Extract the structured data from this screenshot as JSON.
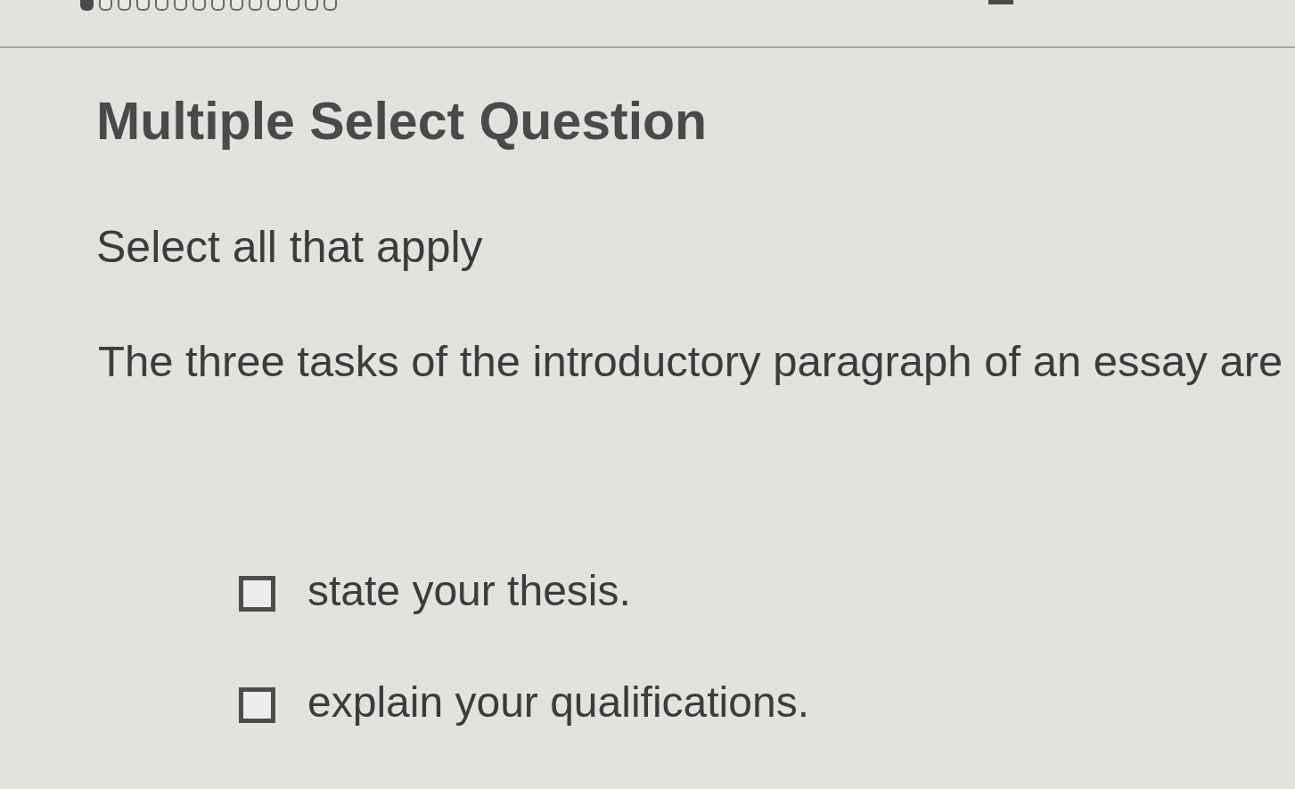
{
  "progress_markers": [
    {
      "filled": true
    },
    {
      "filled": false
    },
    {
      "filled": false
    },
    {
      "filled": false
    },
    {
      "filled": false
    },
    {
      "filled": false
    },
    {
      "filled": false
    },
    {
      "filled": false
    },
    {
      "filled": false
    },
    {
      "filled": false
    },
    {
      "filled": false
    },
    {
      "filled": false
    },
    {
      "filled": false
    },
    {
      "filled": false
    }
  ],
  "title": "Multiple Select Question",
  "instruction": "Select all that apply",
  "question": "The three tasks of the introductory paragraph of an essay are",
  "options": [
    {
      "label": "state your thesis.",
      "checked": false
    },
    {
      "label": "explain your qualifications.",
      "checked": false
    }
  ]
}
